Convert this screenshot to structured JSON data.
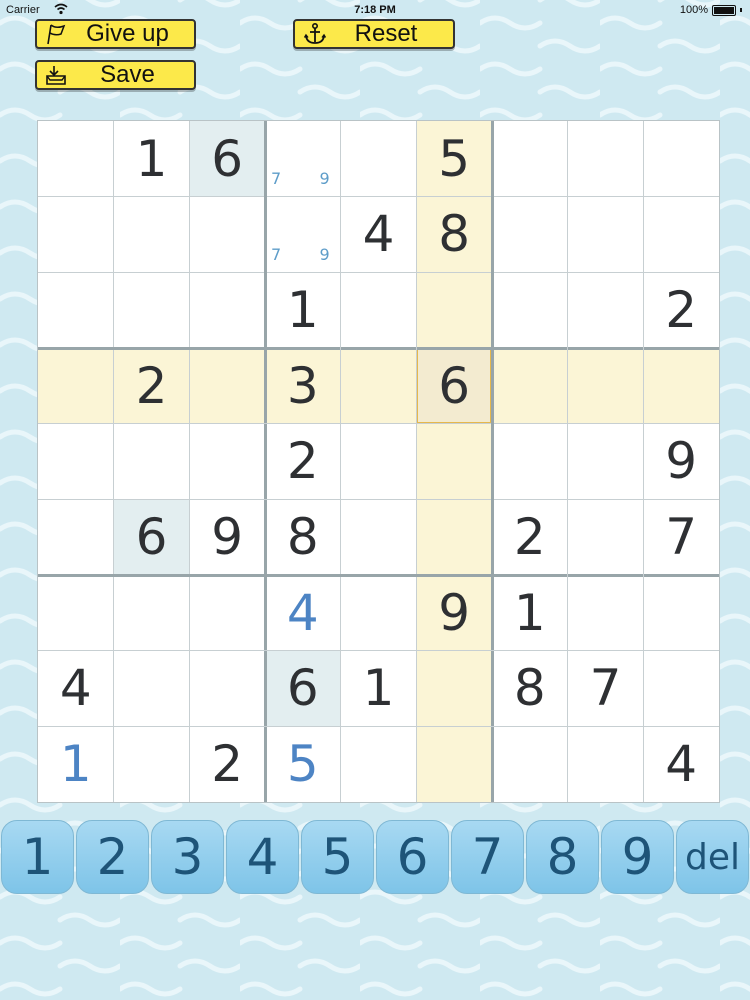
{
  "status_bar": {
    "carrier": "Carrier",
    "time": "7:18 PM",
    "battery": "100%"
  },
  "toolbar": {
    "give_up_label": "Give up",
    "reset_label": "Reset",
    "save_label": "Save"
  },
  "board": {
    "cells": [
      [
        "",
        "1",
        "6",
        "",
        "",
        "5",
        "",
        "",
        ""
      ],
      [
        "",
        "",
        "",
        "",
        "4",
        "8",
        "",
        "",
        ""
      ],
      [
        "",
        "",
        "",
        "1",
        "",
        "",
        "",
        "",
        "2"
      ],
      [
        "",
        "2",
        "",
        "3",
        "",
        "6",
        "",
        "",
        ""
      ],
      [
        "",
        "",
        "",
        "2",
        "",
        "",
        "",
        "",
        "9"
      ],
      [
        "",
        "6",
        "9",
        "8",
        "",
        "",
        "2",
        "",
        "7"
      ],
      [
        "",
        "",
        "",
        "4",
        "",
        "9",
        "1",
        "",
        ""
      ],
      [
        "4",
        "",
        "",
        "6",
        "1",
        "",
        "8",
        "7",
        ""
      ],
      [
        "1",
        "",
        "2",
        "5",
        "",
        "",
        "",
        "",
        "4"
      ]
    ],
    "user_entries": [
      [
        6,
        3
      ],
      [
        8,
        0
      ],
      [
        8,
        3
      ]
    ],
    "notes": [
      {
        "row": 0,
        "col": 3,
        "values": [
          "7",
          "9"
        ]
      },
      {
        "row": 1,
        "col": 3,
        "values": [
          "7",
          "9"
        ]
      }
    ],
    "selected": {
      "row": 3,
      "col": 5
    },
    "same_value_cells": [
      [
        0,
        2
      ],
      [
        5,
        1
      ],
      [
        7,
        3
      ]
    ]
  },
  "number_pad": {
    "keys": [
      "1",
      "2",
      "3",
      "4",
      "5",
      "6",
      "7",
      "8",
      "9",
      "del"
    ]
  },
  "icons": [
    "flag-icon",
    "anchor-icon",
    "save-tray-icon",
    "wifi-icon",
    "battery-icon"
  ],
  "colors": {
    "toolbar_button": "#fce94a",
    "highlight": "#fbf5d6",
    "selected_border": "#e6b84c",
    "user_digit": "#4d84c4",
    "note_digit": "#5e9dc9",
    "keypad": "#8ccbeb"
  }
}
